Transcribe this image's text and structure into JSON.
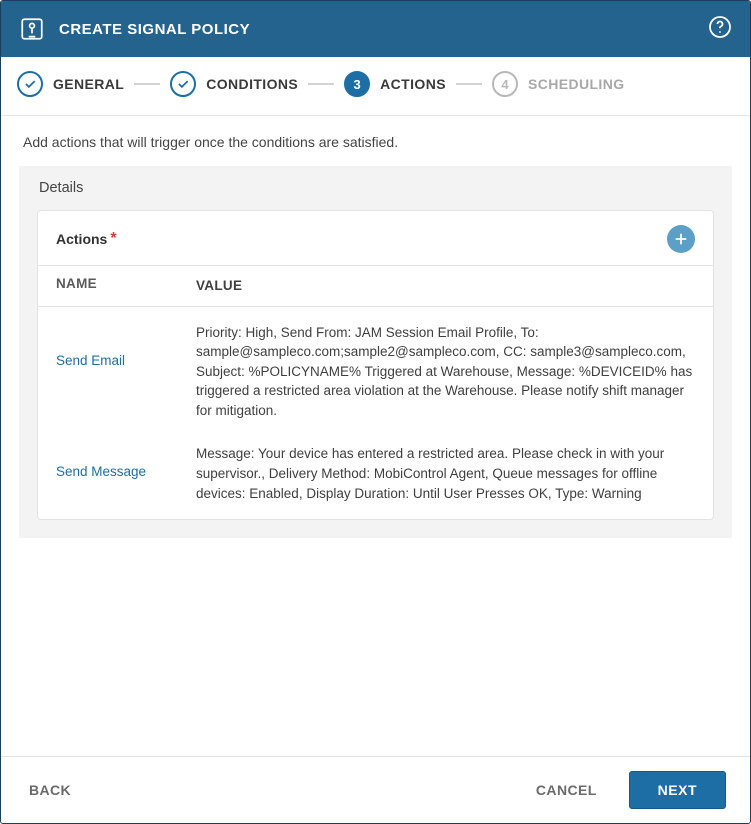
{
  "header": {
    "title": "CREATE SIGNAL POLICY"
  },
  "steps": [
    {
      "label": "GENERAL",
      "state": "done",
      "mark": "check"
    },
    {
      "label": "CONDITIONS",
      "state": "done",
      "mark": "check"
    },
    {
      "label": "ACTIONS",
      "state": "active",
      "mark": "3"
    },
    {
      "label": "SCHEDULING",
      "state": "future",
      "mark": "4"
    }
  ],
  "intro": "Add actions that will trigger once the conditions are satisfied.",
  "panel": {
    "title": "Details"
  },
  "actions_card": {
    "title": "Actions",
    "required_mark": "*",
    "columns": {
      "name": "NAME",
      "value": "VALUE"
    },
    "rows": [
      {
        "name": "Send Email",
        "value": "Priority: High, Send From: JAM Session Email Profile, To: sample@sampleco.com;sample2@sampleco.com, CC: sample3@sampleco.com, Subject: %POLICYNAME% Triggered at Warehouse, Message: %DEVICEID% has triggered a restricted area violation at the Warehouse. Please notify shift manager for mitigation."
      },
      {
        "name": "Send Message",
        "value": "Message: Your device has entered a restricted area. Please check in with your supervisor., Delivery Method: MobiControl Agent, Queue messages for offline devices: Enabled, Display Duration: Until User Presses OK, Type: Warning"
      }
    ]
  },
  "footer": {
    "back": "BACK",
    "cancel": "CANCEL",
    "next": "NEXT"
  },
  "colors": {
    "primary": "#1c6ea4",
    "header_bg": "#25638f"
  }
}
